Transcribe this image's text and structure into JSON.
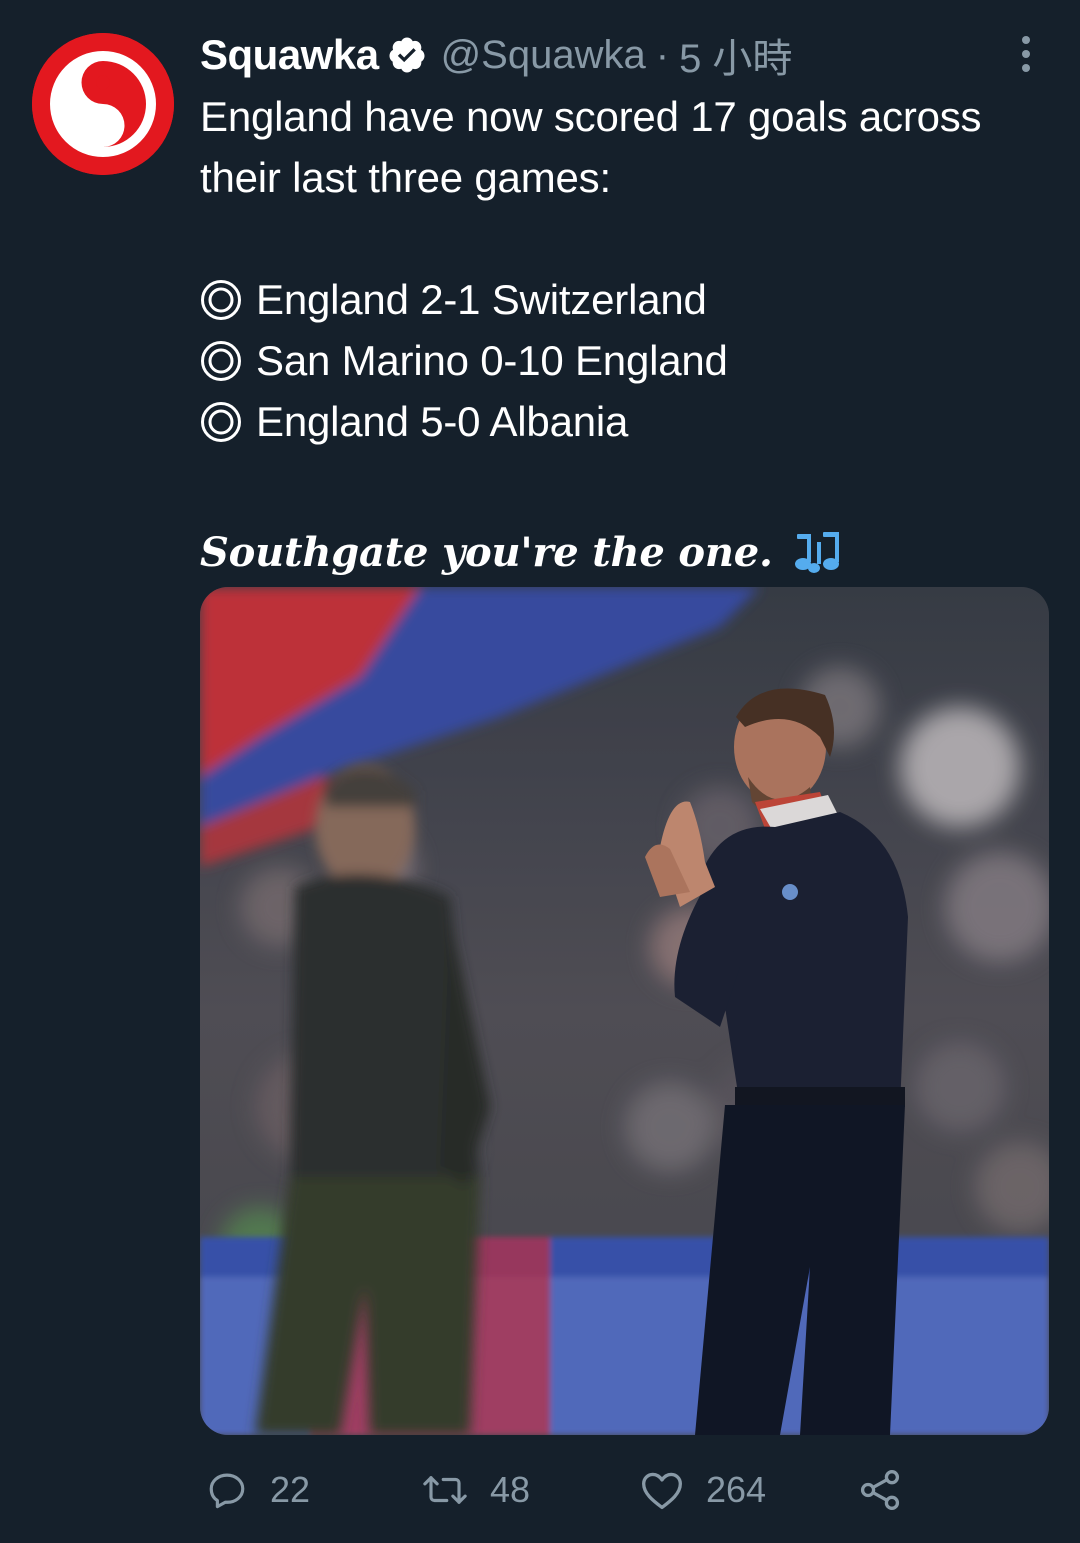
{
  "tweet": {
    "display_name": "Squawka",
    "handle": "@Squawka",
    "separator": "·",
    "time": "5 小時",
    "text_lines": [
      "England have now scored 17 goals across",
      "their last three games:"
    ],
    "results": [
      "England 2-1 Switzerland",
      "San Marino 0-10 England",
      "England 5-0 Albania"
    ],
    "styled_line": "Southgate you're the one.",
    "stats": {
      "replies": "22",
      "retweets": "48",
      "likes": "264"
    }
  },
  "icons": {
    "avatar": "squawka-logo-avatar",
    "verified": "verified-badge-icon",
    "more": "more-vertical-icon",
    "bullet": "double-circle-icon",
    "music": "music-notes-icon",
    "reply": "reply-icon",
    "retweet": "retweet-icon",
    "like": "heart-icon",
    "share": "share-icon"
  },
  "colors": {
    "background": "#15202b",
    "text": "#ffffff",
    "secondary": "#8899a6",
    "brand_red": "#e3181f",
    "verified_badge": "#ffffff",
    "music_notes": "#55acee"
  }
}
